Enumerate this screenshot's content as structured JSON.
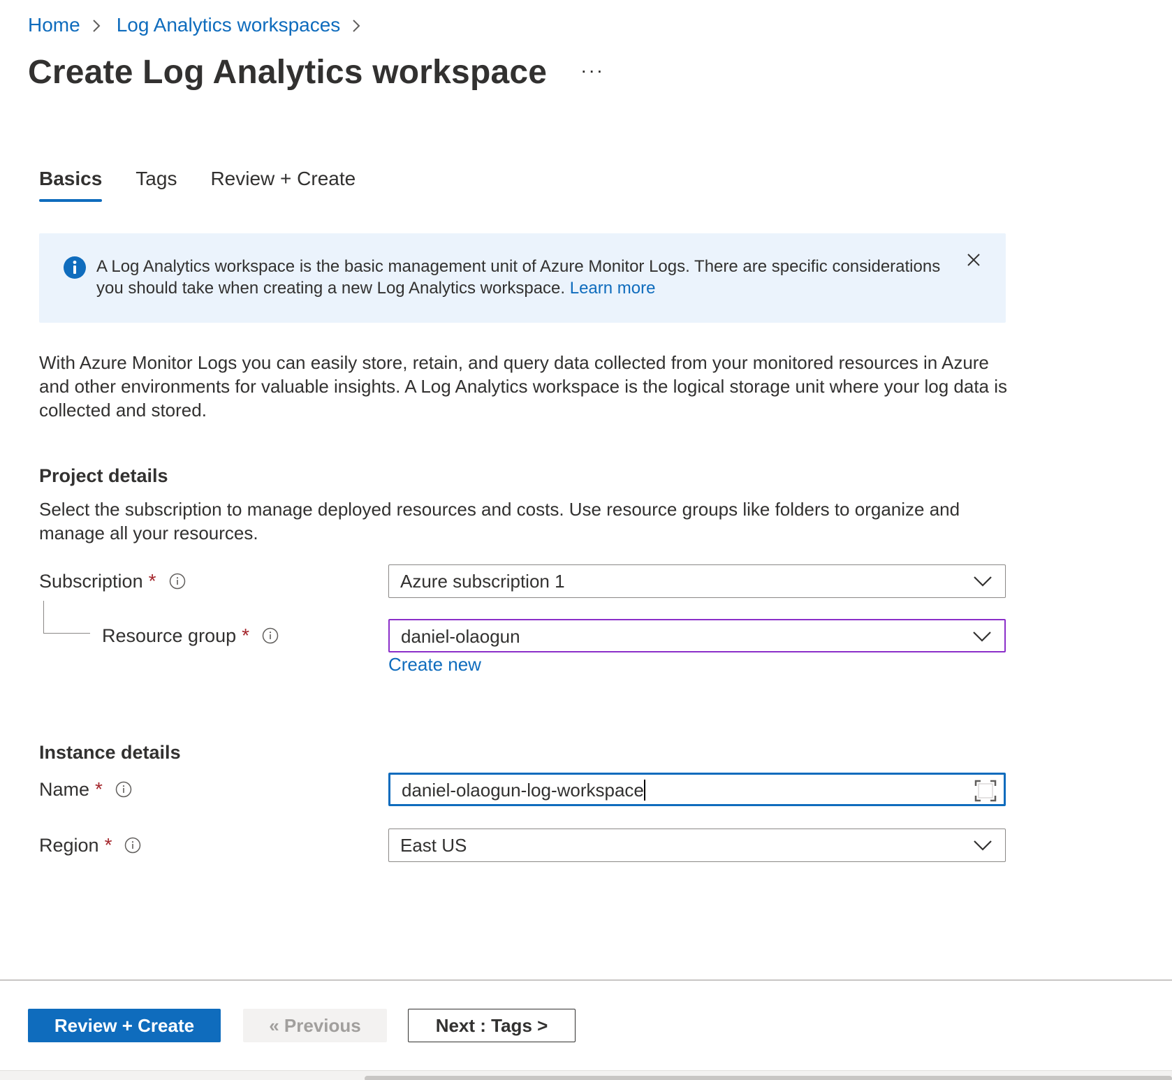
{
  "breadcrumb": {
    "home": "Home",
    "parent": "Log Analytics workspaces"
  },
  "page": {
    "title": "Create Log Analytics workspace",
    "more": "···"
  },
  "tabs": [
    {
      "label": "Basics",
      "active": true
    },
    {
      "label": "Tags",
      "active": false
    },
    {
      "label": "Review + Create",
      "active": false
    }
  ],
  "banner": {
    "text": "A Log Analytics workspace is the basic management unit of Azure Monitor Logs. There are specific considerations you should take when creating a new Log Analytics workspace.",
    "link": "Learn more",
    "icon": "info-icon",
    "accent": "#0f6cbd",
    "background": "#ebf3fc"
  },
  "intro": "With Azure Monitor Logs you can easily store, retain, and query data collected from your monitored resources in Azure and other environments for valuable insights. A Log Analytics workspace is the logical storage unit where your log data is collected and stored.",
  "project": {
    "title": "Project details",
    "description": "Select the subscription to manage deployed resources and costs. Use resource groups like folders to organize and manage all your resources.",
    "subscription": {
      "label": "Subscription",
      "required": "*",
      "value": "Azure subscription 1"
    },
    "resource_group": {
      "label": "Resource group",
      "required": "*",
      "value": "daniel-olaogun",
      "create_new": "Create new"
    }
  },
  "instance": {
    "title": "Instance details",
    "name": {
      "label": "Name",
      "required": "*",
      "value": "daniel-olaogun-log-workspace"
    },
    "region": {
      "label": "Region",
      "required": "*",
      "value": "East US"
    }
  },
  "footer": {
    "review_create": "Review + Create",
    "previous": "« Previous",
    "next": "Next : Tags >"
  },
  "colors": {
    "primary": "#0f6cbd",
    "required": "#a4262c",
    "focus_purple": "#8b2fc9"
  }
}
